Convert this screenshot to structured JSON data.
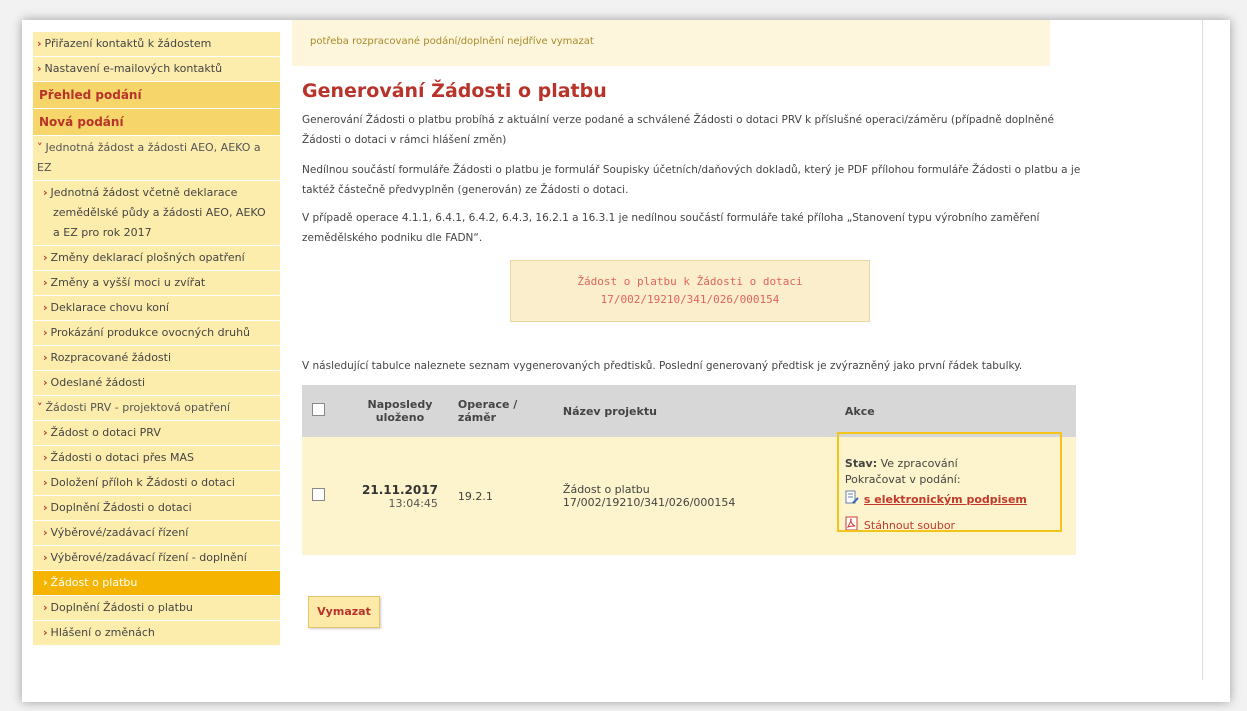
{
  "sidebar": {
    "items": [
      {
        "label": "Přiřazení kontaktů k žádostem",
        "type": "l1"
      },
      {
        "label": "Nastavení e-mailových kontaktů",
        "type": "l1"
      },
      {
        "label": "Přehled podání",
        "type": "hdr"
      },
      {
        "label": "Nová podání",
        "type": "hdr"
      },
      {
        "label": "Jednotná žádost a žádosti AEO, AEKO a EZ",
        "type": "grp"
      },
      {
        "label": "Jednotná žádost včetně deklarace zemědělské půdy a žádosti AEO, AEKO a EZ pro rok 2017",
        "type": "l2"
      },
      {
        "label": "Změny deklarací plošných opatření",
        "type": "l2"
      },
      {
        "label": "Změny a vyšší moci u zvířat",
        "type": "l2"
      },
      {
        "label": "Deklarace chovu koní",
        "type": "l2"
      },
      {
        "label": "Prokázání produkce ovocných druhů",
        "type": "l2"
      },
      {
        "label": "Rozpracované žádosti",
        "type": "l2"
      },
      {
        "label": "Odeslané žádosti",
        "type": "l2"
      },
      {
        "label": "Žádosti PRV - projektová opatření",
        "type": "grp"
      },
      {
        "label": "Žádost o dotaci PRV",
        "type": "l2"
      },
      {
        "label": "Žádosti o dotaci přes MAS",
        "type": "l2"
      },
      {
        "label": "Doložení příloh k Žádosti o dotaci",
        "type": "l2"
      },
      {
        "label": "Doplnění Žádosti o dotaci",
        "type": "l2"
      },
      {
        "label": "Výběrové/zadávací řízení",
        "type": "l2"
      },
      {
        "label": "Výběrové/zadávací řízení - doplnění",
        "type": "l2"
      },
      {
        "label": "Žádost o platbu",
        "type": "l2",
        "active": true
      },
      {
        "label": "Doplnění Žádosti o platbu",
        "type": "l2"
      },
      {
        "label": "Hlášení o změnách",
        "type": "l2"
      }
    ]
  },
  "main": {
    "notice": "potřeba rozpracované podání/doplnění nejdříve vymazat",
    "title": "Generování Žádosti o platbu",
    "p1": "Generování Žádosti o platbu probíhá z aktuální verze podané a schválené Žádosti o dotaci PRV k příslušné operaci/záměru (případně doplněné Žádosti o dotaci v rámci hlášení změn)",
    "p2": "Nedílnou součástí formuláře Žádosti o platbu je formulář Soupisky účetních/daňových dokladů, který je PDF přílohou formuláře Žádosti o platbu a je taktéž částečně předvyplněn (generován) ze Žádosti o dotaci.",
    "p3": "V případě operace 4.1.1, 6.4.1, 6.4.2, 6.4.3, 16.2.1 a 16.3.1 je nedílnou součástí formuláře také příloha „Stanovení typu výrobního zaměření zemědělského podniku dle FADN“.",
    "generate_line1": "Žádost o platbu k Žádosti o dotaci",
    "generate_line2": "17/002/19210/341/026/000154",
    "table_intro": "V následující tabulce naleznete seznam vygenerovaných předtisků. Poslední generovaný předtisk je zvýrazněný jako první řádek tabulky.",
    "table": {
      "headers": {
        "saved": "Naposledy uloženo",
        "operation": "Operace / záměr",
        "project": "Název projektu",
        "actions": "Akce"
      },
      "rows": [
        {
          "date": "21.11.2017",
          "time": "13:04:45",
          "operation": "19.2.1",
          "project": "Žádost o platbu 17/002/19210/341/026/000154",
          "status_key": "Stav:",
          "status_value": "Ve zpracování",
          "continue_label": "Pokračovat v podání:",
          "sign_link": "s elektronickým podpisem",
          "download_link": "Stáhnout soubor"
        }
      ]
    },
    "delete_button": "Vymazat"
  }
}
